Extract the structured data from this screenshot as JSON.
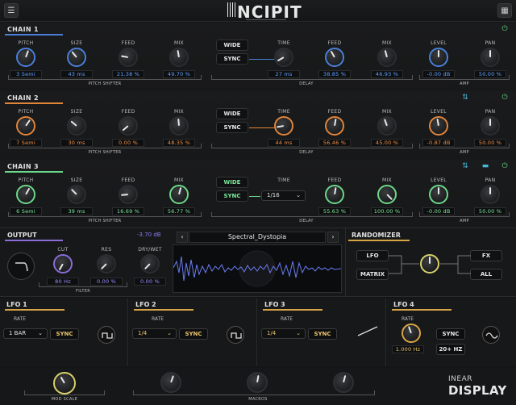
{
  "header": {
    "logo": "NCIPIT",
    "menu_icon": "menu-icon",
    "grid_icon": "grid-icon"
  },
  "labels": {
    "pitch": "PITCH",
    "size": "SIZE",
    "feed": "FEED",
    "mix": "MIX",
    "time": "TIME",
    "level": "LEVEL",
    "pan": "PAN",
    "pitch_shifter": "PITCH SHIFTER",
    "delay": "DELAY",
    "amp": "AMP",
    "wide": "WIDE",
    "sync": "SYNC"
  },
  "chains": [
    {
      "title": "CHAIN 1",
      "accent": "#4a7fd8",
      "pitch": "3 Semi",
      "size": "43 ms",
      "feed": "21.38 %",
      "mix": "49.70 %",
      "time": "27 ms",
      "dfeed": "38.85 %",
      "dmix": "46.93 %",
      "level": "-0.00 dB",
      "pan": "50.00 %"
    },
    {
      "title": "CHAIN 2",
      "accent": "#e0843a",
      "pitch": "7 Semi",
      "size": "30 ms",
      "feed": "0.00 %",
      "mix": "48.35 %",
      "time": "44 ms",
      "dfeed": "56.46 %",
      "dmix": "45.00 %",
      "level": "-0.87 dB",
      "pan": "50.00 %"
    },
    {
      "title": "CHAIN 3",
      "accent": "#6cd88a",
      "pitch": "6 Semi",
      "size": "39 ms",
      "feed": "16.69 %",
      "mix": "56.77 %",
      "time_select": "1/16",
      "dfeed": "55.63 %",
      "dmix": "100.00 %",
      "level": "-0.00 dB",
      "pan": "50.00 %"
    }
  ],
  "output": {
    "title": "OUTPUT",
    "gain": "-3.70 dB",
    "cut_label": "CUT",
    "res_label": "RES",
    "drywet_label": "DRY/WET",
    "cut": "80 Hz",
    "res": "0.00 %",
    "drywet": "0.00 %",
    "filter_label": "FILTER"
  },
  "preset": {
    "name": "Spectral_Dystopia",
    "prev": "‹",
    "next": "›"
  },
  "randomizer": {
    "title": "RANDOMIZER",
    "lfo": "LFO",
    "matrix": "MATRIX",
    "fx": "FX",
    "all": "ALL"
  },
  "lfos": [
    {
      "title": "LFO 1",
      "rate_label": "RATE",
      "rate": "1 BAR",
      "sync": "SYNC"
    },
    {
      "title": "LFO 2",
      "rate_label": "RATE",
      "rate": "1/4",
      "sync": "SYNC"
    },
    {
      "title": "LFO 3",
      "rate_label": "RATE",
      "rate": "1/4",
      "sync": "SYNC"
    },
    {
      "title": "LFO 4",
      "rate_label": "RATE",
      "rate": "1.000 Hz",
      "sync": "SYNC",
      "hz": "20+ HZ"
    }
  ],
  "footer": {
    "mod_scale": "MOD SCALE",
    "macros": "MACROS",
    "brand_top": "INEAR",
    "brand_bottom": "DISPLAY"
  }
}
